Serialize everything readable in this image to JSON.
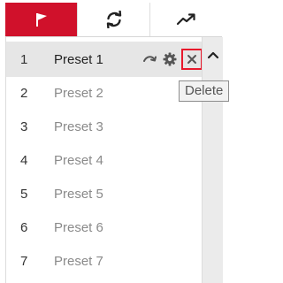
{
  "tabs": [
    {
      "icon": "preset-flag-icon",
      "active": true
    },
    {
      "icon": "patrol-refresh-icon",
      "active": false
    },
    {
      "icon": "pattern-trend-icon",
      "active": false
    }
  ],
  "presets": [
    {
      "number": "1",
      "name": "Preset 1",
      "selected": true
    },
    {
      "number": "2",
      "name": "Preset 2",
      "selected": false
    },
    {
      "number": "3",
      "name": "Preset 3",
      "selected": false
    },
    {
      "number": "4",
      "name": "Preset 4",
      "selected": false
    },
    {
      "number": "5",
      "name": "Preset 5",
      "selected": false
    },
    {
      "number": "6",
      "name": "Preset 6",
      "selected": false
    },
    {
      "number": "7",
      "name": "Preset 7",
      "selected": false
    }
  ],
  "row_actions": [
    {
      "icon": "call-preset-arrow-icon"
    },
    {
      "icon": "settings-gear-icon"
    },
    {
      "icon": "delete-x-icon"
    }
  ],
  "tooltip": {
    "text": "Delete"
  },
  "colors": {
    "active_tab": "#d0112b",
    "selected_row": "#e6e6e6",
    "delete_highlight": "#e8192c"
  }
}
